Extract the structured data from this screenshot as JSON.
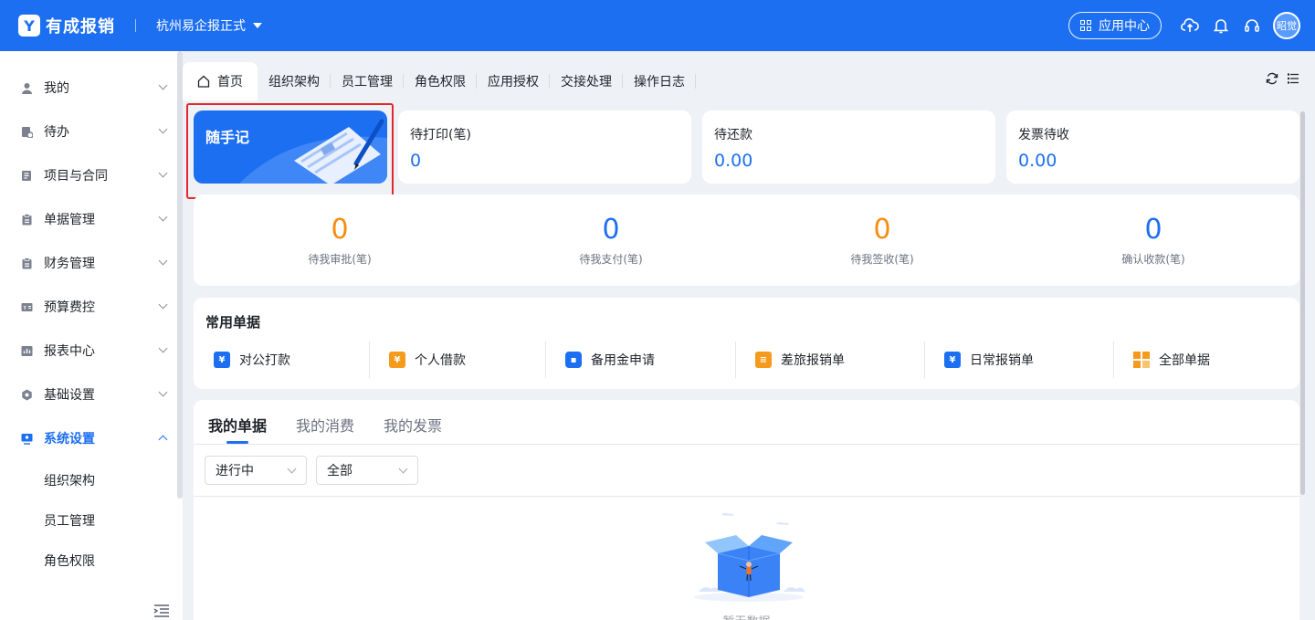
{
  "header": {
    "logo_mark": "Y",
    "app_name": "有成报销",
    "company": "杭州易企报正式",
    "app_center_label": "应用中心",
    "avatar_text": "昭觉"
  },
  "sidebar": {
    "items": [
      {
        "label": "我的",
        "icon": "user-icon"
      },
      {
        "label": "待办",
        "icon": "todo-icon"
      },
      {
        "label": "项目与合同",
        "icon": "project-icon"
      },
      {
        "label": "单据管理",
        "icon": "clipboard-icon"
      },
      {
        "label": "财务管理",
        "icon": "clipboard-icon"
      },
      {
        "label": "预算费控",
        "icon": "budget-icon"
      },
      {
        "label": "报表中心",
        "icon": "report-icon"
      },
      {
        "label": "基础设置",
        "icon": "gear-icon"
      },
      {
        "label": "系统设置",
        "icon": "monitor-icon",
        "active": true
      }
    ],
    "sub_items": [
      "组织架构",
      "员工管理",
      "角色权限"
    ]
  },
  "tabs": [
    "首页",
    "组织架构",
    "员工管理",
    "角色权限",
    "应用授权",
    "交接处理",
    "操作日志"
  ],
  "note_card": {
    "title": "随手记"
  },
  "summary_cards": [
    {
      "label": "待打印(笔)",
      "value": "0"
    },
    {
      "label": "待还款",
      "value": "0.00"
    },
    {
      "label": "发票待收",
      "value": "0.00"
    }
  ],
  "stats": [
    {
      "value": "0",
      "caption": "待我审批(笔)",
      "color": "#f68c0f"
    },
    {
      "value": "0",
      "caption": "待我支付(笔)",
      "color": "#1d6ff2"
    },
    {
      "value": "0",
      "caption": "待我签收(笔)",
      "color": "#f68c0f"
    },
    {
      "value": "0",
      "caption": "确认收款(笔)",
      "color": "#1d6ff2"
    }
  ],
  "common_docs": {
    "title": "常用单据",
    "entries": [
      {
        "label": "对公打款",
        "icon": "transfer-icon",
        "color": "#1d6ff2"
      },
      {
        "label": "个人借款",
        "icon": "loan-icon",
        "color": "#f59a1b"
      },
      {
        "label": "备用金申请",
        "icon": "wallet-icon",
        "color": "#1d6ff2"
      },
      {
        "label": "差旅报销单",
        "icon": "travel-icon",
        "color": "#f59a1b"
      },
      {
        "label": "日常报销单",
        "icon": "receipt-icon",
        "color": "#1d6ff2"
      },
      {
        "label": "全部单据",
        "icon": "grid-icon",
        "color": "#f59a1b"
      }
    ]
  },
  "my_docs": {
    "tabs": [
      "我的单据",
      "我的消费",
      "我的发票"
    ],
    "filters": [
      "进行中",
      "全部"
    ],
    "empty_text": "暂无数据"
  }
}
